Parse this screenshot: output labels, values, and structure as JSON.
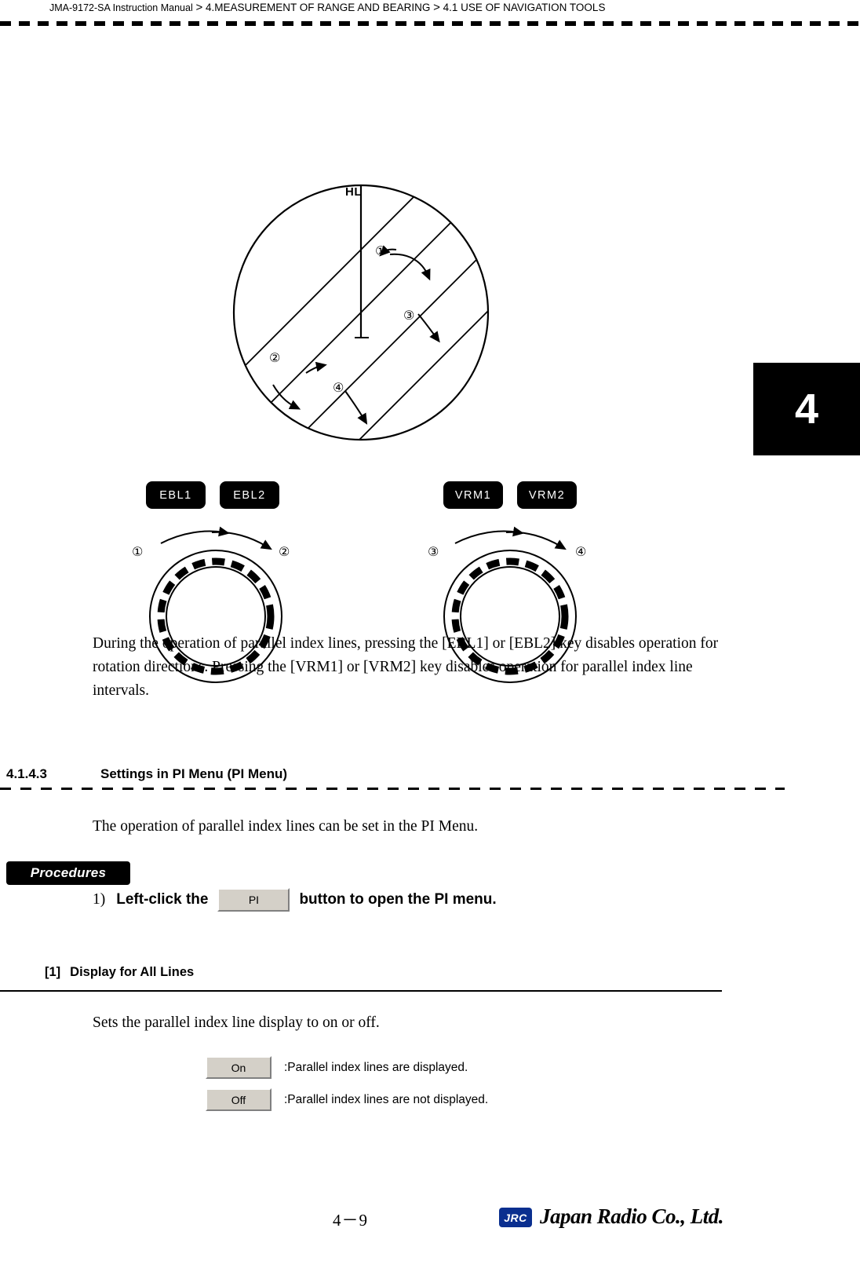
{
  "header": {
    "manual": "JMA-9172-SA Instruction Manual",
    "sep1": ">",
    "chapter": "4.MEASUREMENT OF RANGE AND BEARING",
    "sep2": ">",
    "section": "4.1  USE OF NAVIGATION TOOLS"
  },
  "chapter_tab": "4",
  "figure": {
    "hl_label": "HL",
    "keys": [
      {
        "label": "EBL1"
      },
      {
        "label": "EBL2"
      },
      {
        "label": "VRM1"
      },
      {
        "label": "VRM2"
      }
    ],
    "markers": {
      "one": "①",
      "two": "②",
      "three": "③",
      "four": "④"
    }
  },
  "body": {
    "paragraph_1": "During the operation of parallel index lines, pressing the [EBL1] or [EBL2] key disables operation for rotation directions.  Pressing the [VRM1] or [VRM2] key disables operation for parallel index line intervals.",
    "section_number": "4.1.4.3",
    "section_title": "Settings in PI Menu (PI Menu)",
    "paragraph_2": "The operation of parallel index lines can be set in the PI Menu.",
    "procedures_label": "Procedures",
    "step_1_number": "1)",
    "step_1_before": "Left-click the",
    "step_1_button": "PI",
    "step_1_after": "button to open the PI menu.",
    "subsection_number": "[1]",
    "subsection_title": "Display for All Lines",
    "paragraph_3": "Sets the parallel index line display to on or off.",
    "options": [
      {
        "button": "On",
        "description": ":Parallel index lines are displayed."
      },
      {
        "button": "Off",
        "description": ":Parallel index lines are not displayed."
      }
    ]
  },
  "footer": {
    "page": "4－9",
    "logo_mark": "JRC",
    "logo_name": "Japan Radio Co., Ltd."
  },
  "colors": {
    "key_bg": "#000000",
    "ui_button_face": "#d4d0c8",
    "logo_blue": "#0a2f8f"
  }
}
